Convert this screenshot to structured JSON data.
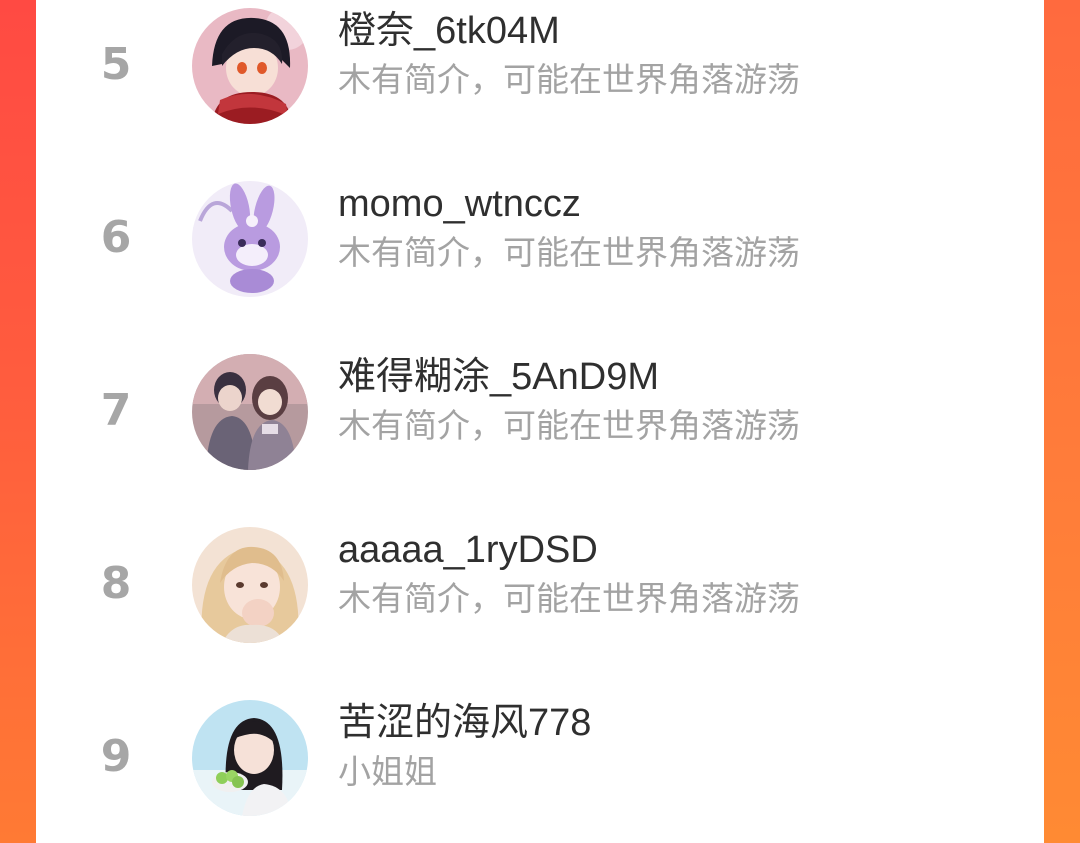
{
  "users": [
    {
      "rank": "5",
      "name": "橙奈_6tk04M",
      "bio": "木有简介，可能在世界角落游荡",
      "avatar_icon": "anime-boy-red-scarf-avatar"
    },
    {
      "rank": "6",
      "name": "momo_wtnccz",
      "bio": "木有简介，可能在世界角落游荡",
      "avatar_icon": "purple-bunny-avatar"
    },
    {
      "rank": "7",
      "name": "难得糊涂_5AnD9M",
      "bio": "木有简介，可能在世界角落游荡",
      "avatar_icon": "anime-couple-avatar"
    },
    {
      "rank": "8",
      "name": "aaaaa_1ryDSD",
      "bio": "木有简介，可能在世界角落游荡",
      "avatar_icon": "blonde-girl-selfie-avatar"
    },
    {
      "rank": "9",
      "name": "苦涩的海风778",
      "bio": "小姐姐",
      "avatar_icon": "girl-with-grapes-avatar"
    }
  ],
  "colors": {
    "background_red": "#ff4a43",
    "background_orange": "#ff8a33",
    "panel": "#ffffff",
    "rank_gray": "#a6a6a6",
    "name_text": "#2f2f2f",
    "bio_text": "#a3a3a3"
  }
}
